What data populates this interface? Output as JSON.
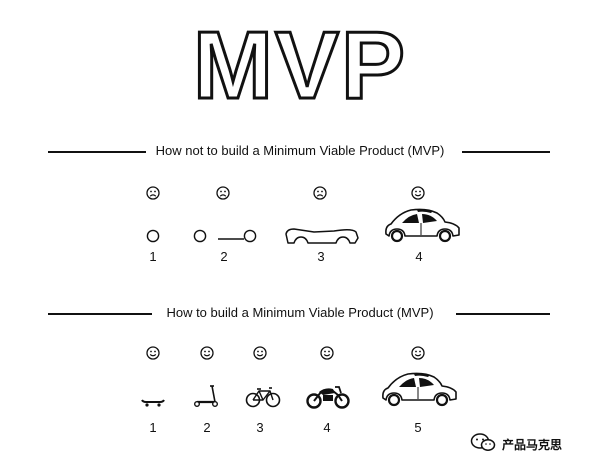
{
  "title": "MVP",
  "sections": [
    {
      "heading": "How not to build a Minimum Viable Product (MVP)",
      "steps": [
        {
          "number": "1",
          "mood": "sad",
          "icon": "wheel-icon"
        },
        {
          "number": "2",
          "mood": "sad",
          "icon": "axle-icon"
        },
        {
          "number": "3",
          "mood": "sad",
          "icon": "car-body-icon"
        },
        {
          "number": "4",
          "mood": "happy",
          "icon": "car-icon"
        }
      ]
    },
    {
      "heading": "How to build a Minimum Viable Product (MVP)",
      "steps": [
        {
          "number": "1",
          "mood": "happy",
          "icon": "skateboard-icon"
        },
        {
          "number": "2",
          "mood": "happy",
          "icon": "scooter-icon"
        },
        {
          "number": "3",
          "mood": "happy",
          "icon": "bicycle-icon"
        },
        {
          "number": "4",
          "mood": "happy",
          "icon": "motorcycle-icon"
        },
        {
          "number": "5",
          "mood": "happy",
          "icon": "car-icon"
        }
      ]
    }
  ],
  "watermark": {
    "text": "产品马克思",
    "icon": "wechat-icon"
  }
}
